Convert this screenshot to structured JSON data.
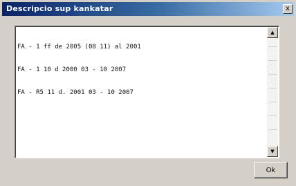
{
  "window": {
    "title": "Descripcio sup kankatar",
    "close_glyph": "x"
  },
  "textarea": {
    "lines": [
      "FA - 1 ff de 2005 (08 11) al 2001",
      "FA - 1 10 d 2000 03 - 10 2007",
      "FA - R5 11 d. 2001 03 - 10 2007"
    ]
  },
  "scrollbar": {
    "up_glyph": "▲",
    "down_glyph": "▼"
  },
  "ok_button": {
    "label": "Ok"
  },
  "colors": {
    "titlebar_start": "#0a246a",
    "titlebar_end": "#a6caf0",
    "dialog_face": "#d4d0c8"
  }
}
